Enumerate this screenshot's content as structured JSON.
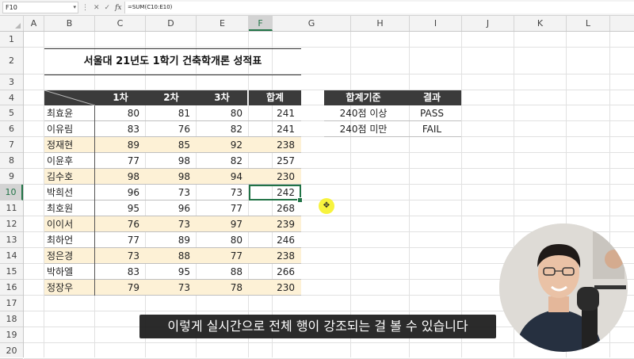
{
  "formula_bar": {
    "name_box": "F10",
    "cancel_icon": "✕",
    "confirm_icon": "✓",
    "fx_label": "fx",
    "formula": "=SUM(C10:E10)"
  },
  "columns": [
    "A",
    "B",
    "C",
    "D",
    "E",
    "F",
    "G",
    "H",
    "I",
    "J",
    "K",
    "L"
  ],
  "rows": [
    "1",
    "2",
    "3",
    "4",
    "5",
    "6",
    "7",
    "8",
    "9",
    "10",
    "11",
    "12",
    "13",
    "14",
    "15",
    "16",
    "17",
    "18",
    "19",
    "20"
  ],
  "selected_cell": {
    "column": "F",
    "row": "10"
  },
  "score_table": {
    "title": "서울대 21년도 1학기 건축학개론 성적표",
    "headers": [
      "1차",
      "2차",
      "3차",
      "합계"
    ],
    "rows": [
      {
        "name": "최효윤",
        "s1": "80",
        "s2": "81",
        "s3": "80",
        "total": "241",
        "highlight": false
      },
      {
        "name": "이유림",
        "s1": "83",
        "s2": "76",
        "s3": "82",
        "total": "241",
        "highlight": false
      },
      {
        "name": "정재현",
        "s1": "89",
        "s2": "85",
        "s3": "92",
        "total": "238",
        "highlight": true
      },
      {
        "name": "이윤후",
        "s1": "77",
        "s2": "98",
        "s3": "82",
        "total": "257",
        "highlight": false
      },
      {
        "name": "김수호",
        "s1": "98",
        "s2": "98",
        "s3": "94",
        "total": "230",
        "highlight": true
      },
      {
        "name": "박희선",
        "s1": "96",
        "s2": "73",
        "s3": "73",
        "total": "242",
        "highlight": false
      },
      {
        "name": "최호원",
        "s1": "95",
        "s2": "96",
        "s3": "77",
        "total": "268",
        "highlight": false
      },
      {
        "name": "이이서",
        "s1": "76",
        "s2": "73",
        "s3": "97",
        "total": "239",
        "highlight": true
      },
      {
        "name": "최하언",
        "s1": "77",
        "s2": "89",
        "s3": "80",
        "total": "246",
        "highlight": false
      },
      {
        "name": "정은경",
        "s1": "73",
        "s2": "88",
        "s3": "77",
        "total": "238",
        "highlight": true
      },
      {
        "name": "박하엘",
        "s1": "83",
        "s2": "95",
        "s3": "88",
        "total": "266",
        "highlight": false
      },
      {
        "name": "정장우",
        "s1": "79",
        "s2": "73",
        "s3": "78",
        "total": "230",
        "highlight": true
      }
    ]
  },
  "criteria_table": {
    "headers": [
      "합계기준",
      "결과"
    ],
    "rows": [
      {
        "criterion": "240점 이상",
        "result": "PASS"
      },
      {
        "criterion": "240점 미만",
        "result": "FAIL"
      }
    ]
  },
  "subtitle": "이렇게 실시간으로 전체 행이 강조되는 걸 볼 수 있습니다",
  "colors": {
    "accent": "#217346",
    "header_bg": "#3b3b3b",
    "band": "#fdf1d6",
    "cursor_highlight": "#f7f22a"
  }
}
